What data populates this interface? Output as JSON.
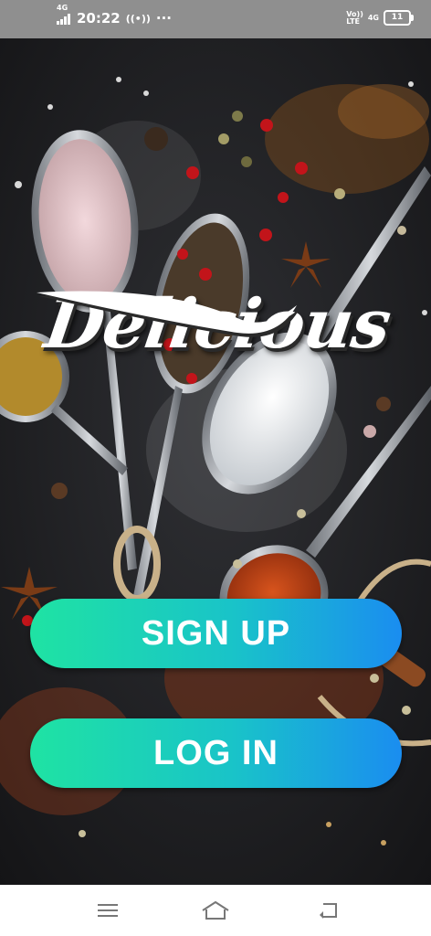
{
  "status_bar": {
    "network_left": "4G",
    "time": "20:22",
    "more": "···",
    "volte": "Vo))\nLTE",
    "network_right": "4G",
    "battery": "11"
  },
  "logo": {
    "text": "Delicious"
  },
  "buttons": {
    "signup_label": "SIGN UP",
    "login_label": "LOG IN"
  },
  "colors": {
    "button_gradient_start": "#1fe3a3",
    "button_gradient_end": "#1a8df0"
  },
  "nav_bar": {
    "icons": [
      "menu-icon",
      "home-icon",
      "back-icon"
    ]
  }
}
